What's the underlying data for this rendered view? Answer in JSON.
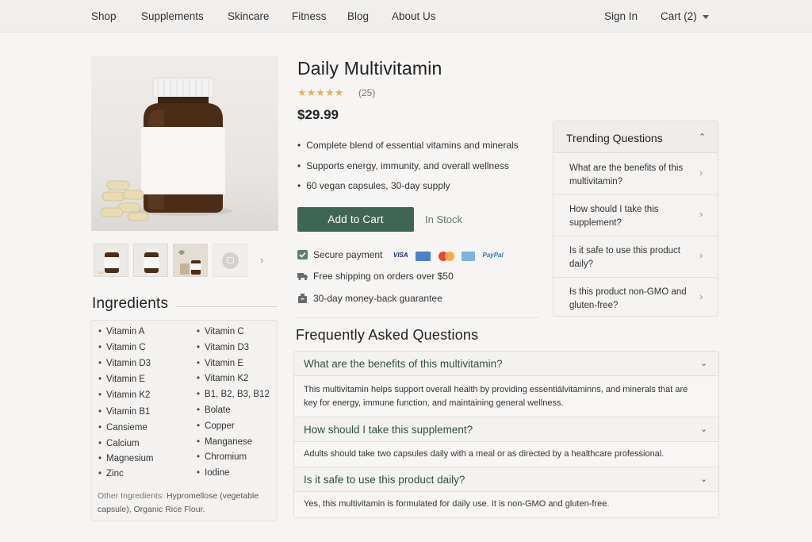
{
  "nav": {
    "left": [
      "Shop",
      "Supplements",
      "Skincare",
      "Fitness",
      "Blog",
      "About Us"
    ],
    "sign_in": "Sign In",
    "cart": "Cart (2)"
  },
  "product": {
    "title": "Daily Multivitamin",
    "stars": "★★★★★",
    "rating_count": "(25)",
    "price": "$29.99",
    "features": [
      "Complete blend of essential vitamins and minerals",
      "Supports energy, immunity, and overall wellness",
      "60 vegan capsules, 30-day supply"
    ],
    "add_to_cart": "Add to Cart",
    "stock": "In Stock",
    "assurances": [
      "Secure payment",
      "Free shipping on orders over $50",
      "30-day money-back guarantee"
    ],
    "payment_logos": [
      "VISA",
      "PayPal"
    ]
  },
  "ingredients": {
    "title": "Ingredients",
    "col1": [
      "Vitamin A",
      "Vitamin C",
      "Vitamin D3",
      "Vitamin E",
      "Vitamin K2",
      "Vitamin B1",
      "Cansieme",
      "Calcium",
      "Magnesium",
      "Zinc"
    ],
    "col2": [
      "Vitamin C",
      "Vitamin D3",
      "Vitamin E",
      "Vitamin K2",
      "B1, B2, B3,  B12",
      "Bolate",
      "Copper",
      "Manganese",
      "Chromium",
      "Iodine"
    ],
    "other_label": "Other Ingredients:",
    "other_text": " Hypromellose (vegetable capsule), Organic Rice Flour."
  },
  "trending": {
    "title": "Trending Questions",
    "questions": [
      "What are the benefits of this multivitamin?",
      "How should I take this supplement?",
      "Is it safe to use this product daily?",
      "Is this product non-GMO and gluten-free?"
    ]
  },
  "faq": {
    "title": "Frequently Asked Questions",
    "items": [
      {
        "q": "What are the benefits of this multivitamin?",
        "a": "This multivitamin helps support overall health by providing essentiálvitaminns, and minerals that are key for energy, immune function, and maintaining general wellness."
      },
      {
        "q": "How should I take this supplement?",
        "a": "Adults should take two capsules daily with a meal or as directed by a healthcare professional."
      },
      {
        "q": "Is it safe to use this product daily?",
        "a": "Yes, this multivitamin is formulated for daily use. It is non-GMO and gluten-free."
      }
    ]
  },
  "colors": {
    "accent_green": "#3f6654",
    "star": "#e2b35b",
    "background": "#f7f5f3"
  },
  "icons": [
    "chevron-down-icon",
    "chevron-up-icon",
    "chevron-right-icon",
    "check-shield-icon",
    "truck-icon",
    "box-icon",
    "camera-icon"
  ]
}
